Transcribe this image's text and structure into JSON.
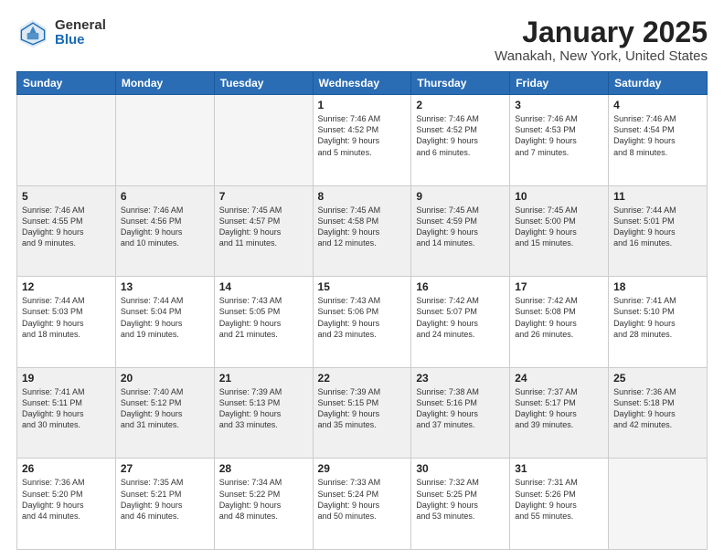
{
  "header": {
    "logo_general": "General",
    "logo_blue": "Blue",
    "title": "January 2025",
    "subtitle": "Wanakah, New York, United States"
  },
  "weekdays": [
    "Sunday",
    "Monday",
    "Tuesday",
    "Wednesday",
    "Thursday",
    "Friday",
    "Saturday"
  ],
  "weeks": [
    [
      {
        "day": "",
        "info": "",
        "empty": true
      },
      {
        "day": "",
        "info": "",
        "empty": true
      },
      {
        "day": "",
        "info": "",
        "empty": true
      },
      {
        "day": "1",
        "info": "Sunrise: 7:46 AM\nSunset: 4:52 PM\nDaylight: 9 hours\nand 5 minutes."
      },
      {
        "day": "2",
        "info": "Sunrise: 7:46 AM\nSunset: 4:52 PM\nDaylight: 9 hours\nand 6 minutes."
      },
      {
        "day": "3",
        "info": "Sunrise: 7:46 AM\nSunset: 4:53 PM\nDaylight: 9 hours\nand 7 minutes."
      },
      {
        "day": "4",
        "info": "Sunrise: 7:46 AM\nSunset: 4:54 PM\nDaylight: 9 hours\nand 8 minutes."
      }
    ],
    [
      {
        "day": "5",
        "info": "Sunrise: 7:46 AM\nSunset: 4:55 PM\nDaylight: 9 hours\nand 9 minutes.",
        "shaded": true
      },
      {
        "day": "6",
        "info": "Sunrise: 7:46 AM\nSunset: 4:56 PM\nDaylight: 9 hours\nand 10 minutes.",
        "shaded": true
      },
      {
        "day": "7",
        "info": "Sunrise: 7:45 AM\nSunset: 4:57 PM\nDaylight: 9 hours\nand 11 minutes.",
        "shaded": true
      },
      {
        "day": "8",
        "info": "Sunrise: 7:45 AM\nSunset: 4:58 PM\nDaylight: 9 hours\nand 12 minutes.",
        "shaded": true
      },
      {
        "day": "9",
        "info": "Sunrise: 7:45 AM\nSunset: 4:59 PM\nDaylight: 9 hours\nand 14 minutes.",
        "shaded": true
      },
      {
        "day": "10",
        "info": "Sunrise: 7:45 AM\nSunset: 5:00 PM\nDaylight: 9 hours\nand 15 minutes.",
        "shaded": true
      },
      {
        "day": "11",
        "info": "Sunrise: 7:44 AM\nSunset: 5:01 PM\nDaylight: 9 hours\nand 16 minutes.",
        "shaded": true
      }
    ],
    [
      {
        "day": "12",
        "info": "Sunrise: 7:44 AM\nSunset: 5:03 PM\nDaylight: 9 hours\nand 18 minutes."
      },
      {
        "day": "13",
        "info": "Sunrise: 7:44 AM\nSunset: 5:04 PM\nDaylight: 9 hours\nand 19 minutes."
      },
      {
        "day": "14",
        "info": "Sunrise: 7:43 AM\nSunset: 5:05 PM\nDaylight: 9 hours\nand 21 minutes."
      },
      {
        "day": "15",
        "info": "Sunrise: 7:43 AM\nSunset: 5:06 PM\nDaylight: 9 hours\nand 23 minutes."
      },
      {
        "day": "16",
        "info": "Sunrise: 7:42 AM\nSunset: 5:07 PM\nDaylight: 9 hours\nand 24 minutes."
      },
      {
        "day": "17",
        "info": "Sunrise: 7:42 AM\nSunset: 5:08 PM\nDaylight: 9 hours\nand 26 minutes."
      },
      {
        "day": "18",
        "info": "Sunrise: 7:41 AM\nSunset: 5:10 PM\nDaylight: 9 hours\nand 28 minutes."
      }
    ],
    [
      {
        "day": "19",
        "info": "Sunrise: 7:41 AM\nSunset: 5:11 PM\nDaylight: 9 hours\nand 30 minutes.",
        "shaded": true
      },
      {
        "day": "20",
        "info": "Sunrise: 7:40 AM\nSunset: 5:12 PM\nDaylight: 9 hours\nand 31 minutes.",
        "shaded": true
      },
      {
        "day": "21",
        "info": "Sunrise: 7:39 AM\nSunset: 5:13 PM\nDaylight: 9 hours\nand 33 minutes.",
        "shaded": true
      },
      {
        "day": "22",
        "info": "Sunrise: 7:39 AM\nSunset: 5:15 PM\nDaylight: 9 hours\nand 35 minutes.",
        "shaded": true
      },
      {
        "day": "23",
        "info": "Sunrise: 7:38 AM\nSunset: 5:16 PM\nDaylight: 9 hours\nand 37 minutes.",
        "shaded": true
      },
      {
        "day": "24",
        "info": "Sunrise: 7:37 AM\nSunset: 5:17 PM\nDaylight: 9 hours\nand 39 minutes.",
        "shaded": true
      },
      {
        "day": "25",
        "info": "Sunrise: 7:36 AM\nSunset: 5:18 PM\nDaylight: 9 hours\nand 42 minutes.",
        "shaded": true
      }
    ],
    [
      {
        "day": "26",
        "info": "Sunrise: 7:36 AM\nSunset: 5:20 PM\nDaylight: 9 hours\nand 44 minutes."
      },
      {
        "day": "27",
        "info": "Sunrise: 7:35 AM\nSunset: 5:21 PM\nDaylight: 9 hours\nand 46 minutes."
      },
      {
        "day": "28",
        "info": "Sunrise: 7:34 AM\nSunset: 5:22 PM\nDaylight: 9 hours\nand 48 minutes."
      },
      {
        "day": "29",
        "info": "Sunrise: 7:33 AM\nSunset: 5:24 PM\nDaylight: 9 hours\nand 50 minutes."
      },
      {
        "day": "30",
        "info": "Sunrise: 7:32 AM\nSunset: 5:25 PM\nDaylight: 9 hours\nand 53 minutes."
      },
      {
        "day": "31",
        "info": "Sunrise: 7:31 AM\nSunset: 5:26 PM\nDaylight: 9 hours\nand 55 minutes."
      },
      {
        "day": "",
        "info": "",
        "empty": true
      }
    ]
  ]
}
